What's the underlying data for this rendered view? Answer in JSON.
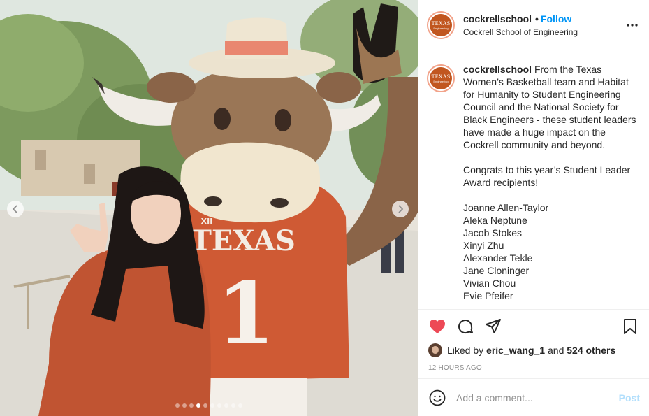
{
  "account": {
    "username": "cockrellschool",
    "separator": "•",
    "follow_label": "Follow",
    "location": "Cockrell School of Engineering",
    "avatar_text": "TEXAS",
    "avatar_subtext": "Engineering"
  },
  "photo": {
    "jersey_text": "TEXAS",
    "jersey_number": "1",
    "patch_text": "XII",
    "carousel_count": 10,
    "carousel_active": 4
  },
  "caption": {
    "username": "cockrellschool",
    "paragraph1": "From the Texas Women’s Basketball team and Habitat for Humanity to Student Engineering Council and the National Society for Black Engineers - these student leaders have made a huge impact on the Cockrell community and beyond.",
    "paragraph2": "Congrats to this year’s Student Leader Award recipients!",
    "names": [
      "Joanne Allen-Taylor",
      "Aleka Neptune",
      "Jacob Stokes",
      "Xinyi Zhu",
      "Alexander Tekle",
      "Jane Cloninger",
      "Vivian Chou",
      "Evie Pfeifer"
    ]
  },
  "engagement": {
    "liked_by_prefix": "Liked by",
    "liked_by_user": "eric_wang_1",
    "and_label": "and",
    "others_label": "524 others",
    "timestamp": "12 HOURS AGO",
    "like_color": "#ed4956"
  },
  "comment": {
    "placeholder": "Add a comment...",
    "post_label": "Post"
  },
  "icons": {
    "more": "more-options-icon",
    "like": "heart-icon",
    "comment": "comment-bubble-icon",
    "share": "paper-plane-icon",
    "save": "bookmark-icon",
    "emoji": "smiley-icon"
  }
}
